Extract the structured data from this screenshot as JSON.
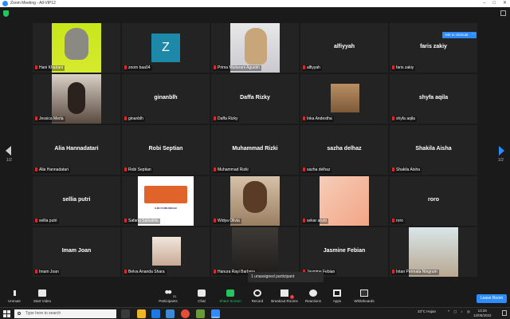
{
  "window": {
    "title": "Zoom Meeting - All-VIP12"
  },
  "page_indicator": {
    "left": "1/2",
    "right": "1/2"
  },
  "tiles": [
    {
      "label": "Hani Khairani"
    },
    {
      "label": "zoom baa04",
      "avatar_letter": "Z"
    },
    {
      "label": "Prima Mutiarani Agustin"
    },
    {
      "label": "alfiyyah",
      "display_name": "alfiyyah"
    },
    {
      "label": "faris zakiy",
      "display_name": "faris zakiy"
    },
    {
      "label": "Jessica Merla"
    },
    {
      "label": "ginanblh",
      "display_name": "ginanblh"
    },
    {
      "label": "Daffa Rizky",
      "display_name": "Daffa Rizky"
    },
    {
      "label": "Inka Andestha"
    },
    {
      "label": "shyfa aqila",
      "display_name": "shyfa aqila"
    },
    {
      "label": "Alia Hannadatari",
      "display_name": "Alia Hannadatari"
    },
    {
      "label": "Robi Septian",
      "display_name": "Robi Septian"
    },
    {
      "label": "Muhammad Rizki",
      "display_name": "Muhammad Rizki"
    },
    {
      "label": "sazha delhaz",
      "display_name": "sazha delhaz"
    },
    {
      "label": "Shakila Aisha",
      "display_name": "Shakila Aisha"
    },
    {
      "label": "sellia putri",
      "display_name": "sellia putri"
    },
    {
      "label": "Safana Salsabila",
      "logo_text": "ILMU KOMUNIKASI"
    },
    {
      "label": "Widya Olivia"
    },
    {
      "label": "sekar arum"
    },
    {
      "label": "roro",
      "display_name": "roro"
    },
    {
      "label": "Imam Joan",
      "display_name": "Imam Joan"
    },
    {
      "label": "Belva Ananda Shara"
    },
    {
      "label": "Hanura Rayi Barbara"
    },
    {
      "label": "Jasmine Febian",
      "display_name": "Jasmine Febian"
    },
    {
      "label": "Intan Permata Ningrum"
    }
  ],
  "overlay": {
    "ask_to_unmute": "Ask to Unmute",
    "more": "···",
    "unassigned_toast": "1 unassigned participant"
  },
  "toolbar": {
    "unmute": "Unmute",
    "start_video": "Start Video",
    "participants": "Participants",
    "participants_count": "31",
    "chat": "Chat",
    "share_screen": "Share Screen",
    "record": "Record",
    "breakout_rooms": "Breakout Rooms",
    "breakout_badge": "1",
    "reactions": "Reactions",
    "apps": "Apps",
    "whiteboards": "Whiteboards",
    "leave": "Leave Room"
  },
  "taskbar": {
    "search_placeholder": "Type here to search",
    "weather": "33°C Hujan",
    "time": "13:26",
    "date": "12/05/2022"
  },
  "colors": {
    "accent": "#2d8cff",
    "share": "#23c55e",
    "muted": "#e02828"
  }
}
